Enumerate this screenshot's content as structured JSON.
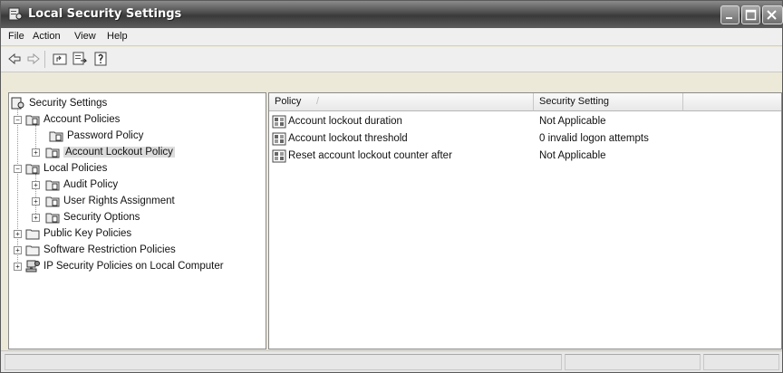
{
  "window": {
    "title": "Local Security Settings"
  },
  "menu": [
    "File",
    "Action",
    "View",
    "Help"
  ],
  "toolbar": [
    "back-icon",
    "forward-icon",
    "up-folder-icon",
    "export-list-icon",
    "help-icon"
  ],
  "tree": {
    "root": "Security Settings",
    "account_policies": "Account Policies",
    "password_policy": "Password Policy",
    "account_lockout_policy": "Account Lockout Policy",
    "local_policies": "Local Policies",
    "audit_policy": "Audit Policy",
    "user_rights": "User Rights Assignment",
    "security_options": "Security Options",
    "public_key": "Public Key Policies",
    "software_restriction": "Software Restriction Policies",
    "ip_security": "IP Security Policies on Local Computer"
  },
  "list": {
    "columns": {
      "policy": "Policy",
      "setting": "Security Setting"
    },
    "sort_glyph": "/",
    "rows": [
      {
        "policy": "Account lockout duration",
        "setting": "Not Applicable"
      },
      {
        "policy": "Account lockout threshold",
        "setting": "0 invalid logon attempts"
      },
      {
        "policy": "Reset account lockout counter after",
        "setting": "Not Applicable"
      }
    ]
  }
}
